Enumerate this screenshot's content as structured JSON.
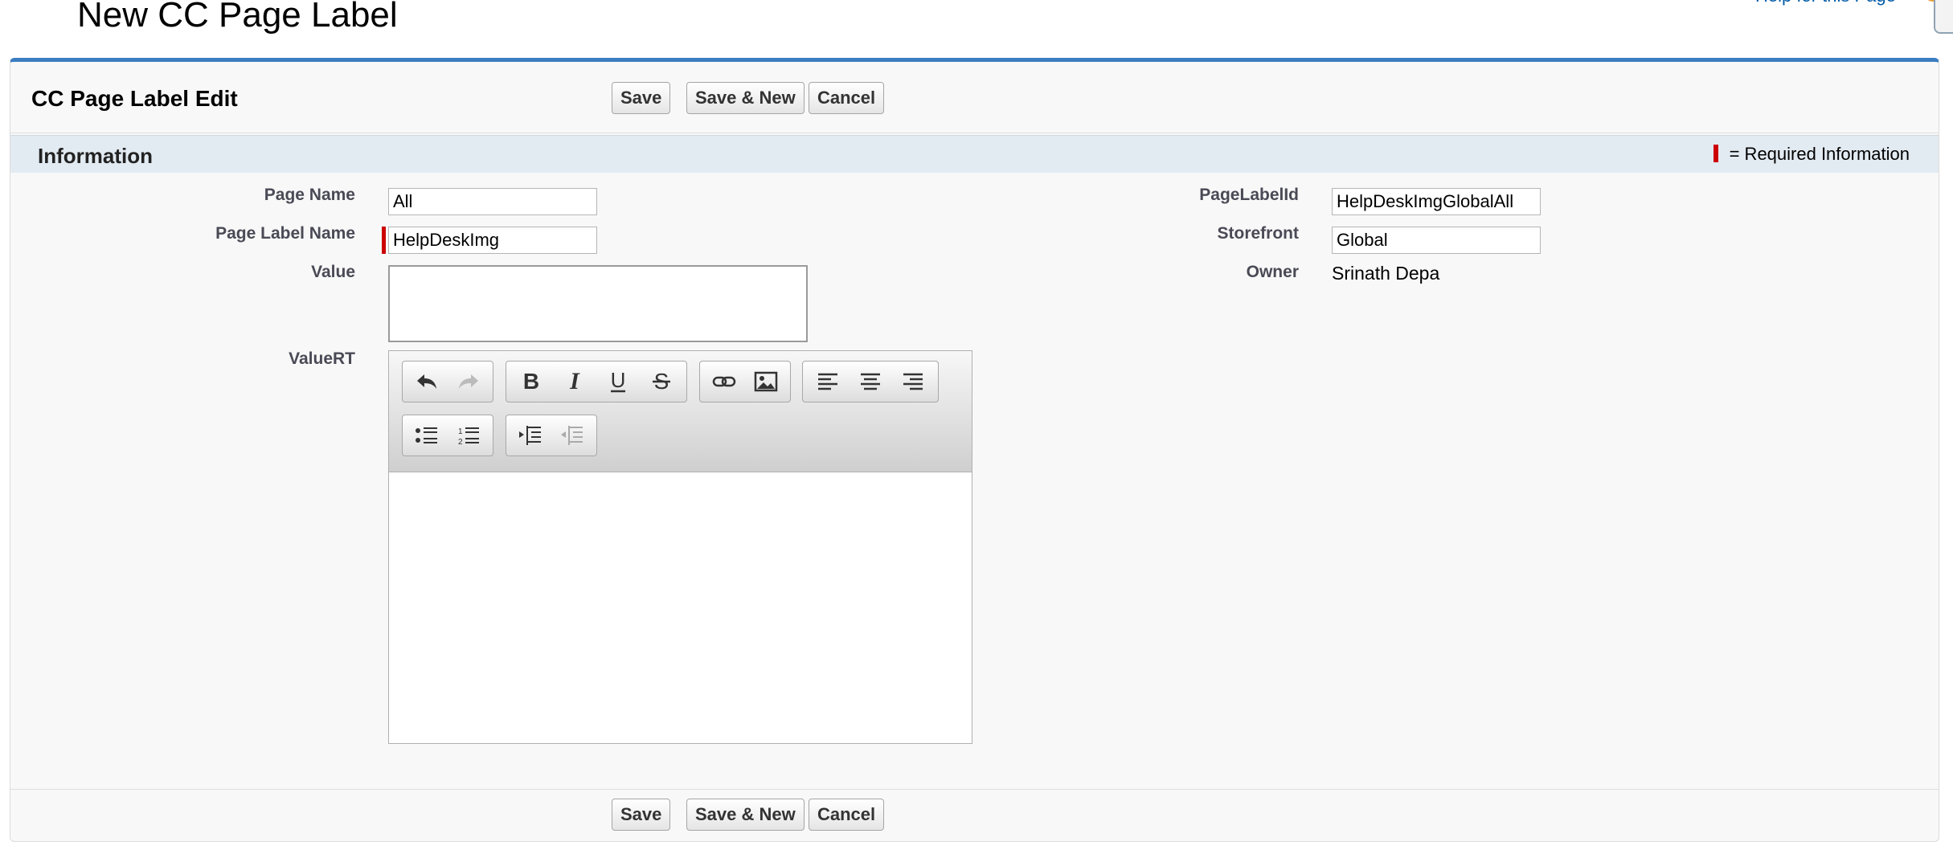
{
  "page": {
    "title": "New CC Page Label",
    "help_link": "Help for this Page"
  },
  "edit": {
    "title": "CC Page Label Edit",
    "buttons": {
      "save": "Save",
      "save_new": "Save & New",
      "cancel": "Cancel"
    }
  },
  "section": {
    "title": "Information",
    "required_legend": "= Required Information"
  },
  "fields": {
    "page_name": {
      "label": "Page Name",
      "value": "All"
    },
    "page_label_name": {
      "label": "Page Label Name",
      "value": "HelpDeskImg",
      "required": true
    },
    "value": {
      "label": "Value",
      "value": ""
    },
    "value_rt": {
      "label": "ValueRT",
      "value": ""
    },
    "page_label_id": {
      "label": "PageLabelId",
      "value": "HelpDeskImgGlobalAll"
    },
    "storefront": {
      "label": "Storefront",
      "value": "Global"
    },
    "owner": {
      "label": "Owner",
      "value": "Srinath Depa"
    }
  },
  "toolbar": {
    "groups": [
      [
        "undo-icon",
        "redo-icon"
      ],
      [
        "bold-icon",
        "italic-icon",
        "underline-icon",
        "strikethrough-icon"
      ],
      [
        "link-icon",
        "image-icon"
      ],
      [
        "align-left-icon",
        "align-center-icon",
        "align-right-icon"
      ],
      [
        "bulleted-list-icon",
        "numbered-list-icon"
      ],
      [
        "indent-icon",
        "outdent-icon"
      ]
    ],
    "disabled": [
      "redo-icon",
      "outdent-icon"
    ]
  },
  "colors": {
    "accent": "#3c7dc0",
    "required": "#cc0000",
    "section_bg": "#e3ebf2"
  }
}
